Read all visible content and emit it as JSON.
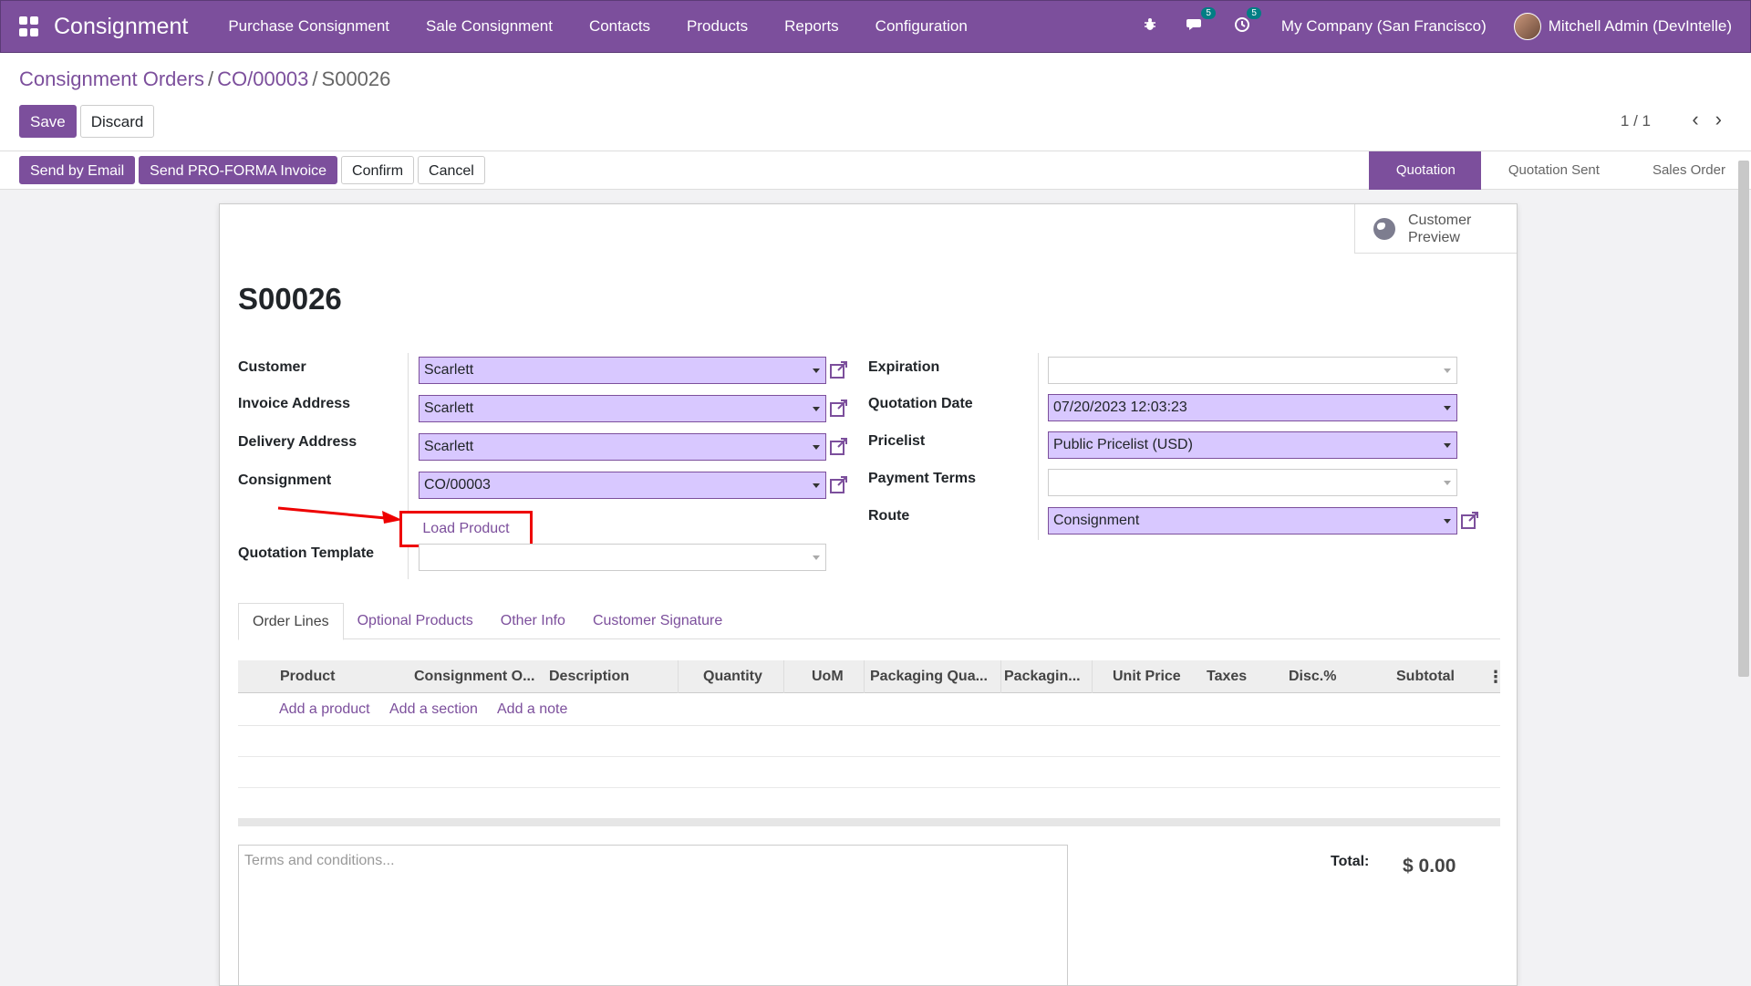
{
  "app": {
    "name": "Consignment"
  },
  "nav": {
    "menu": [
      "Purchase Consignment",
      "Sale Consignment",
      "Contacts",
      "Products",
      "Reports",
      "Configuration"
    ],
    "messages_count": "5",
    "activities_count": "5",
    "company": "My Company (San Francisco)",
    "user": "Mitchell Admin (DevIntelle)"
  },
  "breadcrumb": {
    "root": "Consignment Orders",
    "parent": "CO/00003",
    "current": "S00026"
  },
  "control": {
    "save_label": "Save",
    "discard_label": "Discard",
    "pager": "1 / 1"
  },
  "status_buttons": {
    "send_email": "Send by Email",
    "proforma": "Send PRO-FORMA Invoice",
    "confirm": "Confirm",
    "cancel": "Cancel"
  },
  "stages": {
    "quotation": "Quotation",
    "sent": "Quotation Sent",
    "sales_order": "Sales Order"
  },
  "smart_button": {
    "label_line1": "Customer",
    "label_line2": "Preview"
  },
  "order": {
    "name": "S00026"
  },
  "left_fields": {
    "customer": {
      "label": "Customer",
      "value": "Scarlett"
    },
    "invoice_address": {
      "label": "Invoice Address",
      "value": "Scarlett"
    },
    "delivery_address": {
      "label": "Delivery Address",
      "value": "Scarlett"
    },
    "consignment": {
      "label": "Consignment",
      "value": "CO/00003"
    },
    "load_product_label": "Load Product",
    "quotation_template": {
      "label": "Quotation Template",
      "value": ""
    }
  },
  "right_fields": {
    "expiration": {
      "label": "Expiration",
      "value": ""
    },
    "quotation_date": {
      "label": "Quotation Date",
      "value": "07/20/2023 12:03:23"
    },
    "pricelist": {
      "label": "Pricelist",
      "value": "Public Pricelist (USD)"
    },
    "payment_terms": {
      "label": "Payment Terms",
      "value": ""
    },
    "route": {
      "label": "Route",
      "value": "Consignment"
    }
  },
  "tabs": [
    "Order Lines",
    "Optional Products",
    "Other Info",
    "Customer Signature"
  ],
  "order_lines": {
    "columns": [
      "Product",
      "Consignment O...",
      "Description",
      "Quantity",
      "UoM",
      "Packaging Qua...",
      "Packagin...",
      "Unit Price",
      "Taxes",
      "Disc.%",
      "Subtotal"
    ],
    "add_product": "Add a product",
    "add_section": "Add a section",
    "add_note": "Add a note"
  },
  "terms_placeholder": "Terms and conditions...",
  "totals": {
    "label": "Total:",
    "value": "$ 0.00"
  },
  "colors": {
    "primary": "#7c4f9c",
    "highlight_field": "#d8c8ff",
    "annotation": "#e00000",
    "badge": "#017e84"
  }
}
